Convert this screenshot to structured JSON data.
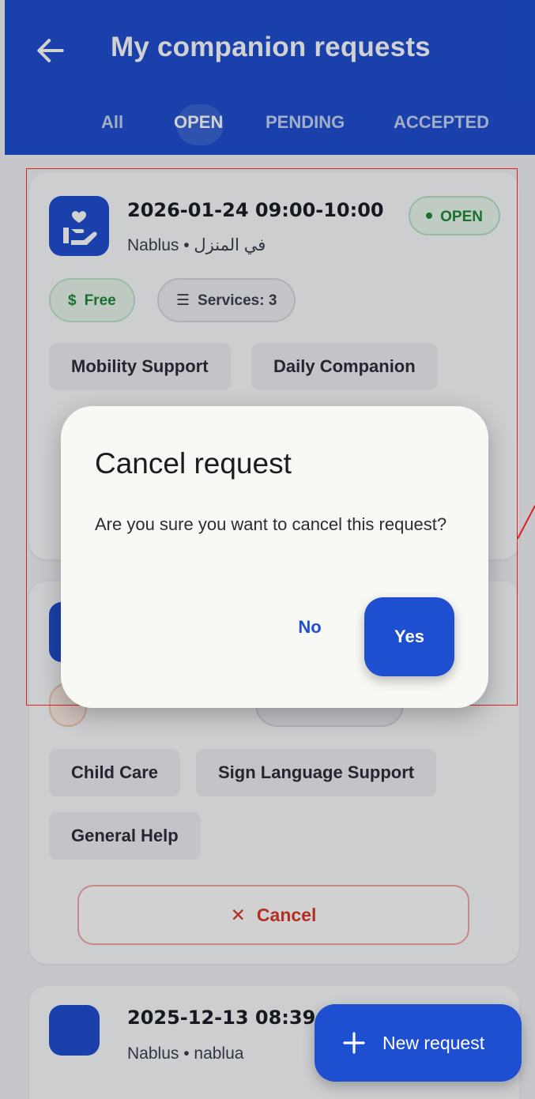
{
  "appbar": {
    "title": "My companion requests",
    "back_icon": "arrow-left-icon",
    "tabs": [
      {
        "label": "All",
        "active": false
      },
      {
        "label": "OPEN",
        "active": true
      },
      {
        "label": "PENDING",
        "active": false
      },
      {
        "label": "ACCEPTED",
        "active": false
      }
    ]
  },
  "requests": [
    {
      "date": "2026-01-24  09:00-10:00",
      "location": "Nablus • في المنزل",
      "status": "OPEN",
      "price": "Free",
      "services_count": "Services: 3",
      "services": [
        "Mobility Support",
        "Daily Companion"
      ]
    },
    {
      "services": [
        "Child Care",
        "Sign Language Support",
        "General Help"
      ],
      "cancel_label": "Cancel"
    },
    {
      "date": "2025-12-13  08:39-",
      "location": "Nablus • nablua"
    }
  ],
  "dialog": {
    "title": "Cancel request",
    "message": "Are you sure you want to cancel this request?",
    "no_label": "No",
    "yes_label": "Yes"
  },
  "fab": {
    "label": "New request",
    "icon": "plus-icon"
  },
  "colors": {
    "primary": "#1f4fd1",
    "open_green": "#1f8a3c",
    "cancel_red": "#d83a2e"
  }
}
